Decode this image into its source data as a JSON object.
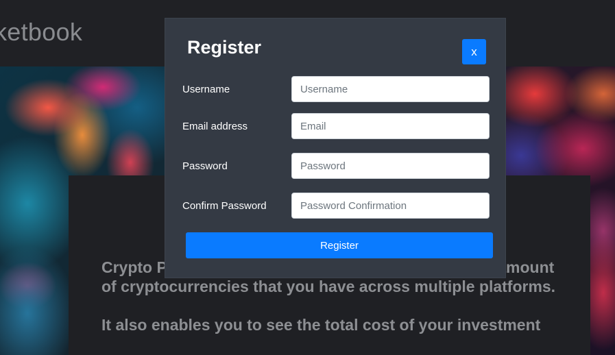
{
  "navbar": {
    "brand": "ketbook"
  },
  "about": {
    "paragraph_1": "Crypto P                                    s you to track the total amount of cryptocurrencies that you have across multiple platforms.",
    "paragraph_2": "It also enables you to see the total cost of your investment"
  },
  "modal": {
    "title": "Register",
    "close_label": "x",
    "fields": [
      {
        "label": "Username",
        "placeholder": "Username"
      },
      {
        "label": "Email address",
        "placeholder": "Email"
      },
      {
        "label": "Password",
        "placeholder": "Password"
      },
      {
        "label": "Confirm Password",
        "placeholder": "Password Confirmation"
      }
    ],
    "submit_label": "Register"
  },
  "colors": {
    "accent": "#0a7bff",
    "modal_bg": "#343a44",
    "page_bg": "#1c1d21"
  }
}
